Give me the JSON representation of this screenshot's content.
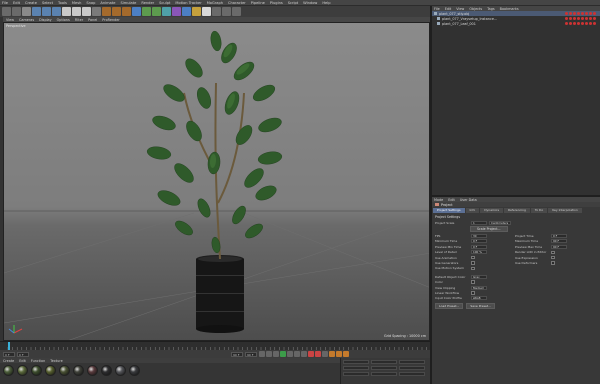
{
  "menubar": [
    "File",
    "Edit",
    "Create",
    "Select",
    "Tools",
    "Mesh",
    "Snap",
    "Animate",
    "Simulate",
    "Render",
    "Sculpt",
    "Motion Tracker",
    "MoGraph",
    "Character",
    "Pipeline",
    "Plugins",
    "Script",
    "Window",
    "Help"
  ],
  "viewport": {
    "menu": [
      "View",
      "Cameras",
      "Display",
      "Options",
      "Filter",
      "Panel",
      "ProRender"
    ],
    "label": "Perspective",
    "grid_spacing": "Grid Spacing : 10000 cm"
  },
  "objects": {
    "menu": [
      "File",
      "Edit",
      "View",
      "Objects",
      "Tags",
      "Bookmarks"
    ],
    "items": [
      "plant_077_stly.obj",
      "plant_077_Vraysetup_Instance...",
      "plant_077_Leaf_001"
    ]
  },
  "attributes": {
    "menu": [
      "Mode",
      "Edit",
      "User Data"
    ],
    "title": "Project",
    "tabs": [
      "Project Settings",
      "Info",
      "Dynamics",
      "Referencing",
      "To Do",
      "Key Interpolation"
    ],
    "section": "Project Settings",
    "project_scale_label": "Project Scale",
    "project_scale_value": "1",
    "project_scale_unit": "Centimeters",
    "scale_button": "Scale Project...",
    "rows": [
      [
        {
          "label": "FPS",
          "value": "30"
        },
        {
          "label": "Project Time",
          "value": "0 F"
        }
      ],
      [
        {
          "label": "Minimum Time",
          "value": "0 F"
        },
        {
          "label": "Maximum Time",
          "value": "90 F"
        }
      ],
      [
        {
          "label": "Preview Min Time",
          "value": "0 F"
        },
        {
          "label": "Preview Max Time",
          "value": "90 F"
        }
      ],
      [
        {
          "label": "Level of Detail",
          "value": "100 %"
        },
        {
          "label": "Render LOD in Editor",
          "value": ""
        }
      ],
      [
        {
          "label": "Use Animation",
          "value": ""
        },
        {
          "label": "Use Expression",
          "value": ""
        }
      ],
      [
        {
          "label": "Use Generators",
          "value": ""
        },
        {
          "label": "Use Deformers",
          "value": ""
        }
      ],
      [
        {
          "label": "Use Motion System",
          "value": ""
        },
        {
          "label": "",
          "value": ""
        }
      ]
    ],
    "lower_rows": [
      {
        "label": "Default Object Color",
        "value": "Gray Blue"
      },
      {
        "label": "Color",
        "value": ""
      },
      {
        "label": "View Clipping",
        "value": "Medium"
      },
      {
        "label": "Linear Workflow",
        "value": ""
      },
      {
        "label": "Input Color Profile",
        "value": "sRGB"
      }
    ],
    "bottom_buttons": [
      "Load Preset...",
      "Save Preset..."
    ]
  },
  "timeline": {
    "fields": [
      "0 F",
      "0 F",
      "90 F",
      "90 F"
    ]
  },
  "materials": {
    "menu": [
      "Create",
      "Edit",
      "Function",
      "Texture"
    ],
    "swatch_colors": [
      "#4c5e3a",
      "#5c6b3c",
      "#3e4f2e",
      "#57602f",
      "#4a5234",
      "#40423a",
      "#5a3c3e",
      "#2e2e30",
      "#55565a",
      "#3a3b3e"
    ]
  }
}
